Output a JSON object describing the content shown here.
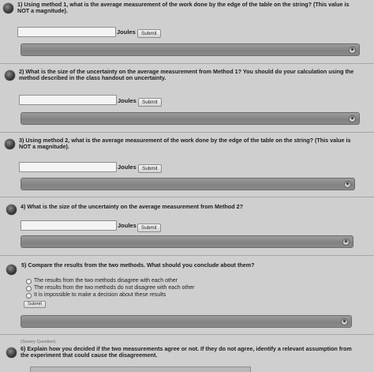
{
  "questions": [
    {
      "text": "1) Using method 1, what is the average measurement of the work done by the edge of the table on the string? (This value is NOT a magnitude).",
      "unit": "Joules",
      "submit_label": "Submit"
    },
    {
      "text": "2) What is the size of the uncertainty on the average measurement from Method 1? You should do your calculation using the method described in the class handout on uncertainty.",
      "unit": "Joules",
      "submit_label": "Submit"
    },
    {
      "text": "3) Using method 2, what is the average measurement of the work done by the edge of the table on the string? (This value is NOT a magnitude).",
      "unit": "Joules",
      "submit_label": "Submit"
    },
    {
      "text": "4) What is the size of the uncertainty on the average measurement from Method 2?",
      "unit": "Joules",
      "submit_label": "Submit"
    },
    {
      "text": "5) Compare the results from the two methods. What should you conclude about them?",
      "options": [
        "The results from the two methods disagree with each other",
        "The results from the two methods do not disagree with each other",
        "It is impossible to make a decision about these results"
      ],
      "submit_label": "Submit"
    },
    {
      "tag": "(Survey Question)",
      "text": "6) Explain how you decided if the two measurements agree or not. If they do not agree, identify a relevant assumption from the experiment that could cause the disagreement."
    }
  ],
  "toggle_symbol": "◉",
  "colors": {
    "background": "#cfcfcf",
    "bar": "#8a8a8a",
    "input": "#f4f4f4"
  }
}
